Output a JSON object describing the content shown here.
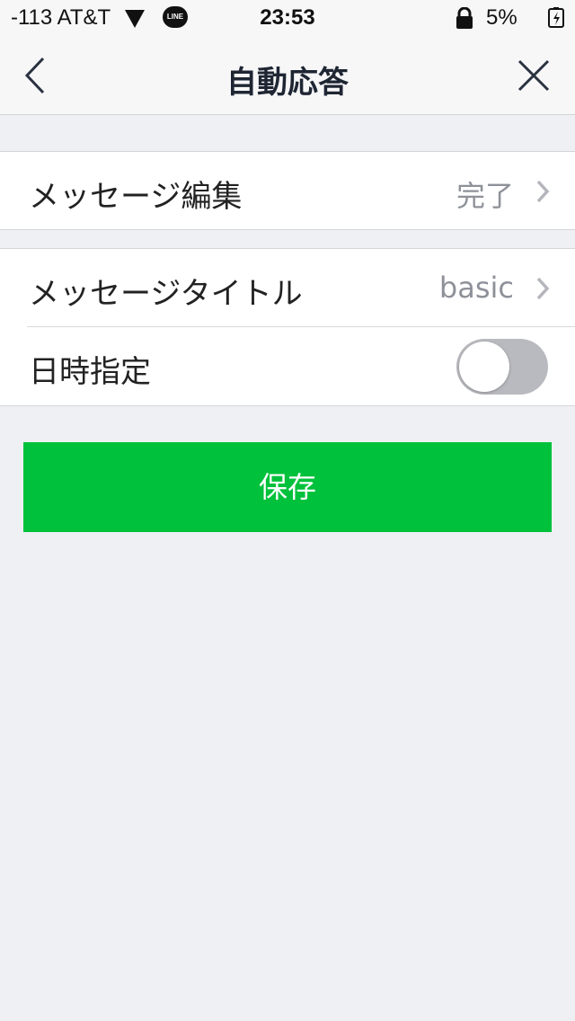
{
  "status_bar": {
    "carrier": "-113 AT&T",
    "line_badge": "LINE",
    "time": "23:53",
    "battery": "5%",
    "charging_glyph": "S"
  },
  "nav": {
    "title": "自動応答",
    "back_icon": "chevron-left-icon",
    "close_icon": "close-icon"
  },
  "settings": {
    "message_edit": {
      "label": "メッセージ編集",
      "value": "完了"
    },
    "message_title": {
      "label": "メッセージタイトル",
      "value": "basic"
    },
    "schedule": {
      "label": "日時指定",
      "enabled": false
    }
  },
  "actions": {
    "save_label": "保存"
  },
  "colors": {
    "accent_green": "#00c13b",
    "background": "#eff0f4",
    "toggle_off": "#b9babf",
    "secondary_text": "#8e9199"
  }
}
